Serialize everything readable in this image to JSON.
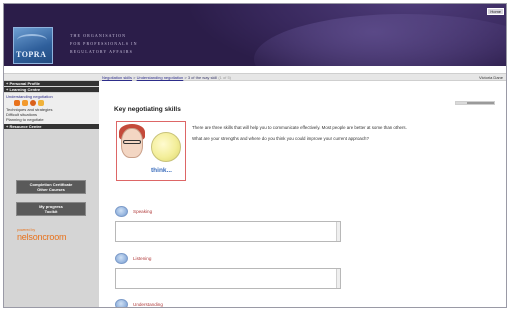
{
  "header": {
    "org_lines": [
      "THE ORGANISATION",
      "FOR PROFESSIONALS IN",
      "REGULATORY AFFAIRS"
    ],
    "logo_text": "TOPRA",
    "home_label": "Home"
  },
  "breadcrumb": {
    "part1": "Negotiation skills",
    "sep1": " > ",
    "part2": "Understanding negotiation",
    "sep2": " > ",
    "part3": "3 of the way skill",
    "page": "(1 of 5)",
    "user": "Victoria Dane"
  },
  "sidebar": {
    "personal_profile": "+ Personal Profile",
    "learning_centre": "+ Learning Centre",
    "items": [
      "Understanding negotiation",
      "Techniques and strategies",
      "Difficult situations",
      "Planning to negotiate"
    ],
    "resource_centre": "+ Resource Centre",
    "btn1": [
      "Completion Certificate",
      "Other Courses"
    ],
    "btn2": [
      "My progress",
      "Toolkit"
    ],
    "nelson_small": "powered by",
    "nelson_big": "nelsoncroom"
  },
  "main": {
    "title": "Key negotiating skills",
    "progress": 0.3,
    "think_word": "think...",
    "intro_p1": "There are three skills that will help you to communicate effectively. Most people are better at some than others.",
    "intro_p2": "What are your strengths and where do you think you could improve your current approach?",
    "skills": [
      "Speaking",
      "Listening",
      "Understanding"
    ]
  },
  "colors": {
    "header_bg": "#2b1d49",
    "section_bg": "#333333",
    "accent_orange": "#e8721c",
    "skill_label": "#b03a3a"
  }
}
